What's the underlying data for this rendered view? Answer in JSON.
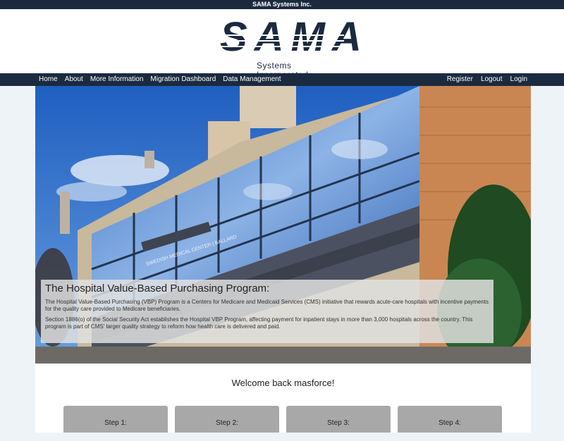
{
  "topbar": {
    "title": "SAMA Systems Inc."
  },
  "logo": {
    "word": "SAMA",
    "subtitle": "Systems Incorporated"
  },
  "nav": {
    "left": [
      "Home",
      "About",
      "More Information",
      "Migration Dashboard",
      "Data Management"
    ],
    "right": [
      "Register",
      "Logout",
      "Login"
    ]
  },
  "hero": {
    "title": "The Hospital Value-Based Purchasing Program:",
    "paragraph1": "The Hospital Value-Based Purchasing (VBP) Program is a Centers for Medicare and Medicaid Services (CMS) initiative that rewards acute-care hospitals with incentive payments for the quality care provided to Medicare beneficiaries.",
    "paragraph2": "Section 1886(o) of the Social Security Act establishes the Hospital VBP Program, affecting payment for inpatient stays in more than 3,000 hospitals across the country. This program is part of CMS' larger quality strategy to reform how health care is delivered and paid.",
    "building_sign": "SWEDISH MEDICAL CENTER | BALLARD"
  },
  "welcome": "Welcome back masforce!",
  "steps": [
    "Step 1:",
    "Step 2:",
    "Step 3:",
    "Step 4:"
  ]
}
